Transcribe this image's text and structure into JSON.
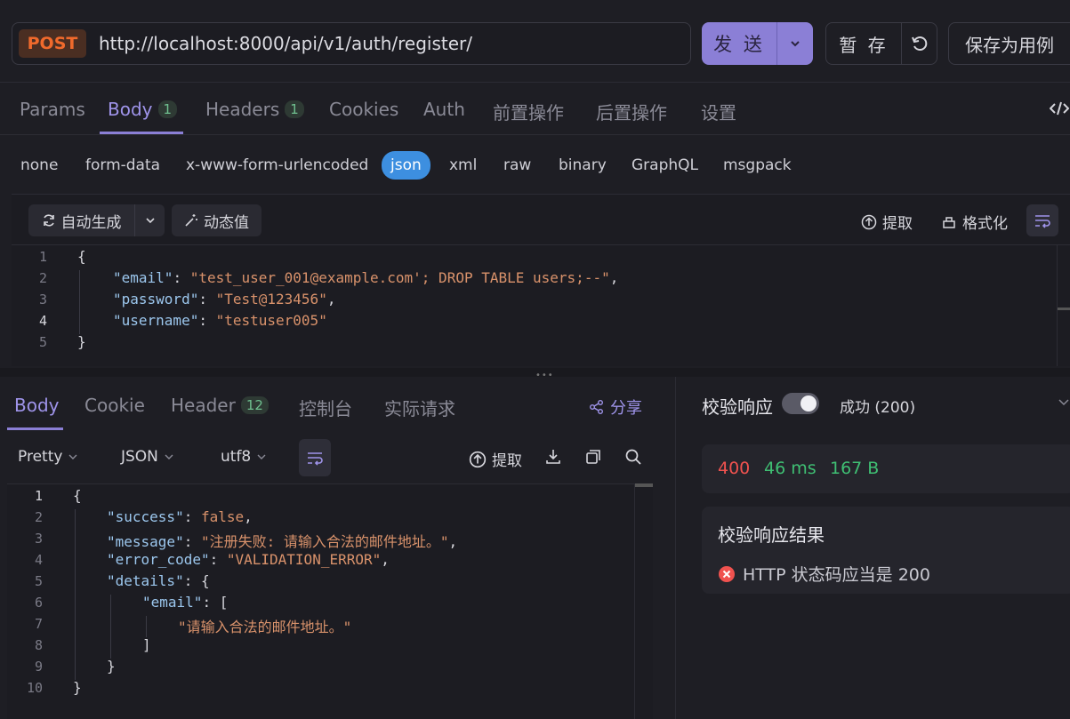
{
  "request": {
    "method": "POST",
    "url": "http://localhost:8000/api/v1/auth/register/",
    "send_label": "发 送",
    "save_draft_label": "暂 存",
    "save_case_label": "保存为用例"
  },
  "req_tabs": [
    {
      "label": "Params"
    },
    {
      "label": "Body",
      "badge": "1"
    },
    {
      "label": "Headers",
      "badge": "1"
    },
    {
      "label": "Cookies"
    },
    {
      "label": "Auth"
    },
    {
      "label": "前置操作"
    },
    {
      "label": "后置操作"
    },
    {
      "label": "设置"
    }
  ],
  "body_types": [
    "none",
    "form-data",
    "x-www-form-urlencoded",
    "json",
    "xml",
    "raw",
    "binary",
    "GraphQL",
    "msgpack"
  ],
  "editor_toolbar": {
    "auto_generate": "自动生成",
    "dynamic_value": "动态值",
    "extract": "提取",
    "format": "格式化"
  },
  "request_body": {
    "line_numbers": [
      "1",
      "2",
      "3",
      "4",
      "5"
    ],
    "lines": [
      {
        "open": "{"
      },
      {
        "key": "\"email\"",
        "value": "\"test_user_001@example.com'; DROP TABLE users;--\"",
        "tail": ","
      },
      {
        "key": "\"password\"",
        "value": "\"Test@123456\"",
        "tail": ","
      },
      {
        "key": "\"username\"",
        "value": "\"testuser005\"",
        "tail": ""
      },
      {
        "open": "}"
      }
    ]
  },
  "response_tabs": [
    {
      "label": "Body"
    },
    {
      "label": "Cookie"
    },
    {
      "label": "Header",
      "badge": "12"
    },
    {
      "label": "控制台"
    },
    {
      "label": "实际请求"
    }
  ],
  "share_label": "分享",
  "response_toolbar": {
    "pretty": "Pretty",
    "format": "JSON",
    "encoding": "utf8",
    "extract": "提取"
  },
  "response_body": {
    "line_numbers": [
      "1",
      "2",
      "3",
      "4",
      "5",
      "6",
      "7",
      "8",
      "9",
      "10"
    ],
    "l2_key": "\"success\"",
    "l2_val": "false",
    "l3_key": "\"message\"",
    "l3_val": "\"注册失败: 请输入合法的邮件地址。\"",
    "l4_key": "\"error_code\"",
    "l4_val": "\"VALIDATION_ERROR\"",
    "l5_key": "\"details\"",
    "l6_key": "\"email\"",
    "l7_val": "\"请输入合法的邮件地址。\""
  },
  "validation": {
    "title": "校验响应",
    "mode": "成功 (200)",
    "status_code": "400",
    "time": "46 ms",
    "size": "167 B",
    "result_title": "校验响应结果",
    "result_message": "HTTP 状态码应当是 200"
  },
  "colors": {
    "accent": "#8b7fd6",
    "method": "#f06a2c",
    "error": "#f0524f",
    "success": "#3fbf73",
    "json_active": "#3d8fe0"
  }
}
